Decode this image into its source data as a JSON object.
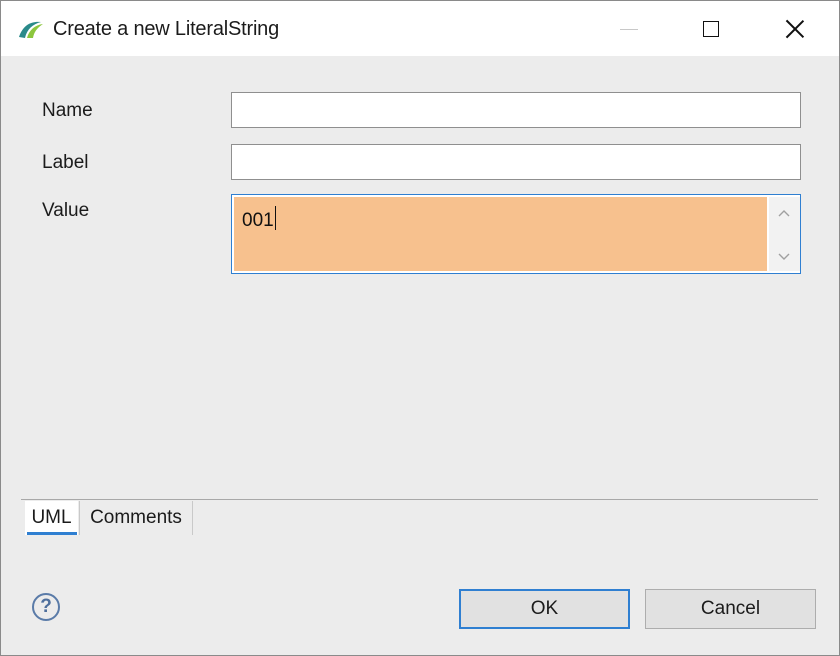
{
  "window": {
    "title": "Create a new LiteralString",
    "icon": "eclipse-app-icon"
  },
  "form": {
    "name_label": "Name",
    "name_value": "",
    "label_label": "Label",
    "label_value": "",
    "value_label": "Value",
    "value_text": "001"
  },
  "tabs": [
    {
      "label": "UML",
      "selected": true
    },
    {
      "label": "Comments",
      "selected": false
    }
  ],
  "buttons": {
    "ok": "OK",
    "cancel": "Cancel",
    "help_icon": "question-mark-icon"
  },
  "colors": {
    "value_highlight": "#f7c18e",
    "focus_accent": "#2f7fd1"
  }
}
